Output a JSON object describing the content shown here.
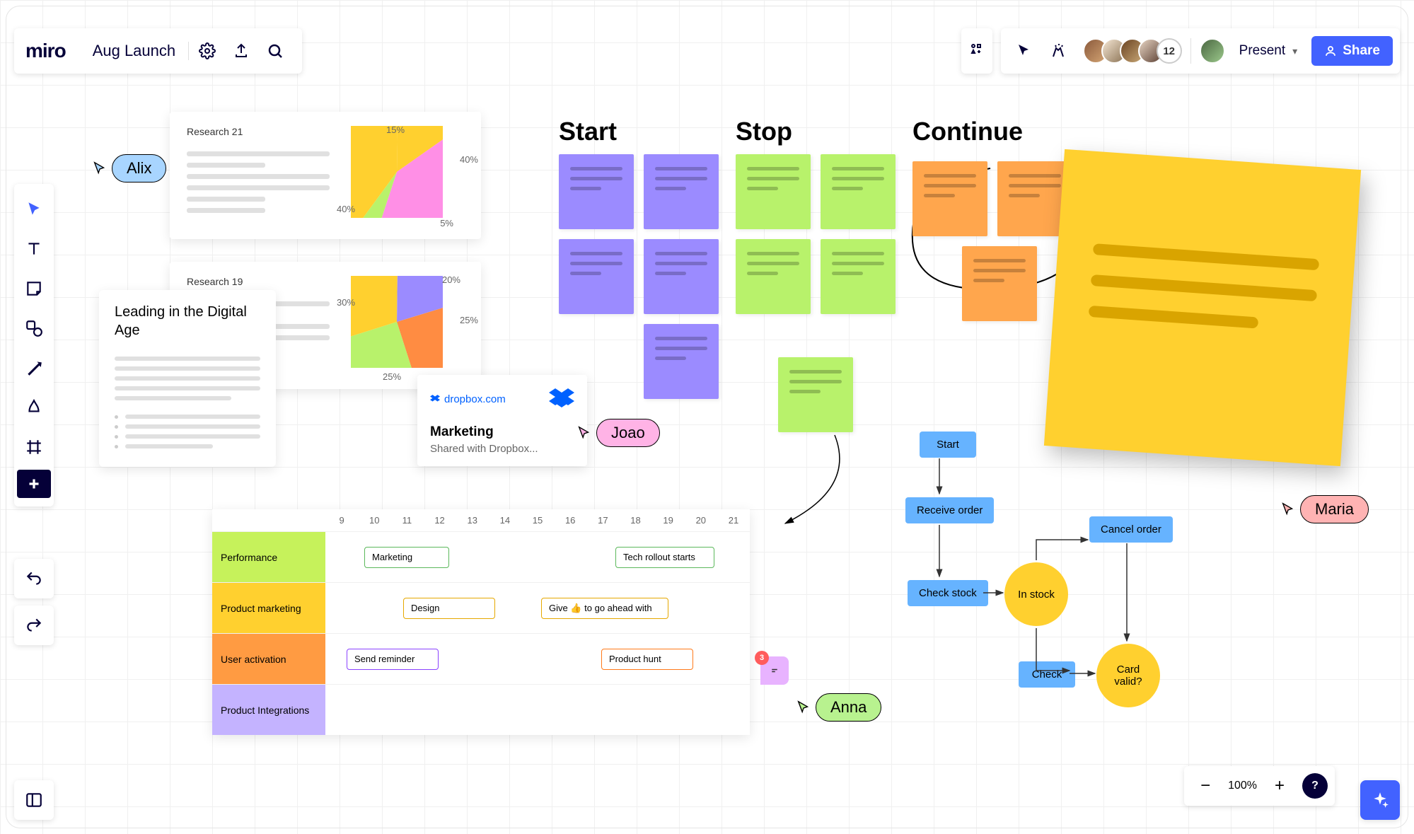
{
  "app": {
    "logo": "miro",
    "board_title": "Aug Launch"
  },
  "header": {
    "avatar_overflow": "12",
    "present_label": "Present",
    "share_label": "Share"
  },
  "zoom": {
    "level": "100%",
    "help": "?"
  },
  "cursors": {
    "alix": {
      "name": "Alix",
      "color": "#A8D5FF"
    },
    "joao": {
      "name": "Joao",
      "color": "#FFB3E6"
    },
    "anna": {
      "name": "Anna",
      "color": "#B8F28F"
    },
    "maria": {
      "name": "Maria",
      "color": "#FFB3B3"
    }
  },
  "columns": {
    "start": "Start",
    "stop": "Stop",
    "continue": "Continue"
  },
  "sticky_colors": {
    "purple": "#9B8BFF",
    "green": "#B8F26B",
    "orange": "#FFA64D",
    "yellow": "#FFD02F"
  },
  "docs": {
    "lead": {
      "title": "Leading in the Digital Age"
    },
    "research1": {
      "title": "Research 21"
    },
    "research2": {
      "title": "Research 19"
    },
    "dropbox": {
      "url": "dropbox.com",
      "title": "Marketing",
      "subtitle": "Shared with Dropbox..."
    }
  },
  "chart_data": [
    {
      "type": "pie",
      "title": "Research 21",
      "series": [
        {
          "label": "15%",
          "value": 15,
          "color": "#FFD02F"
        },
        {
          "label": "40%",
          "value": 40,
          "color": "#FF8FE6"
        },
        {
          "label": "5%",
          "value": 5,
          "color": "#B8F26B"
        },
        {
          "label": "40%",
          "value": 40,
          "color": "#FFD02F"
        }
      ]
    },
    {
      "type": "pie",
      "title": "Research 19",
      "series": [
        {
          "label": "20%",
          "value": 20,
          "color": "#9B8BFF"
        },
        {
          "label": "25%",
          "value": 25,
          "color": "#FF8C42"
        },
        {
          "label": "25%",
          "value": 25,
          "color": "#B8F26B"
        },
        {
          "label": "30%",
          "value": 30,
          "color": "#FFD02F"
        }
      ]
    }
  ],
  "timeline": {
    "columns": [
      "9",
      "10",
      "11",
      "12",
      "13",
      "14",
      "15",
      "16",
      "17",
      "18",
      "19",
      "20",
      "21"
    ],
    "rows": [
      {
        "label": "Performance",
        "color": "#C6F25B",
        "bars": [
          {
            "text": "Marketing",
            "start": 11,
            "span": 2.4,
            "border": "#5BB85B"
          },
          {
            "text": "Tech rollout starts",
            "start": 17,
            "span": 2.4,
            "border": "#5BB85B"
          }
        ]
      },
      {
        "label": "Product marketing",
        "color": "#FFD02F",
        "bars": [
          {
            "text": "Design",
            "start": 12,
            "span": 2.4,
            "border": "#E6A800"
          },
          {
            "text": "Give 👍 to go ahead with",
            "start": 15,
            "span": 3.2,
            "border": "#E6A800"
          }
        ]
      },
      {
        "label": "User activation",
        "color": "#FF9B42",
        "bars": [
          {
            "text": "Send reminder",
            "start": 10,
            "span": 2.4,
            "border": "#8B42FF"
          },
          {
            "text": "Product hunt",
            "start": 17,
            "span": 2.4,
            "border": "#FF7A1A"
          }
        ]
      },
      {
        "label": "Product Integrations",
        "color": "#C4B3FF",
        "bars": []
      }
    ]
  },
  "flowchart": {
    "nodes": {
      "start": "Start",
      "receive": "Receive order",
      "check_stock": "Check stock",
      "in_stock": "In stock",
      "cancel": "Cancel order",
      "check": "Check",
      "card_valid": "Card valid?"
    }
  },
  "comment": {
    "count": "3"
  }
}
